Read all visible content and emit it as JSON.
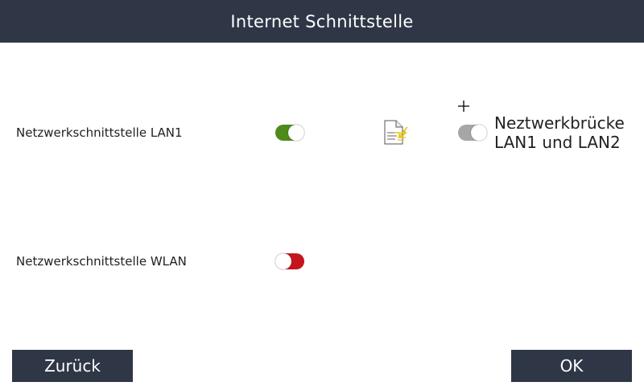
{
  "header": {
    "title": "Internet Schnittstelle"
  },
  "settings": [
    {
      "label": "Netzwerkschnittstelle LAN1",
      "state": "on",
      "color": "#4f8a1c"
    },
    {
      "label": "Netzwerkschnittstelle WLAN",
      "state": "off",
      "color": "#c4151c"
    }
  ],
  "bridge": {
    "line1": "Neztwerkbrücke",
    "line2": "LAN1 und LAN2",
    "state": "off",
    "color": "#a6a6a6",
    "icon": "document-transfer-icon"
  },
  "footer": {
    "back_label": "Zurück",
    "ok_label": "OK"
  },
  "colors": {
    "header_bg": "#2f3747",
    "button_bg": "#2f3747",
    "text": "#222222"
  }
}
